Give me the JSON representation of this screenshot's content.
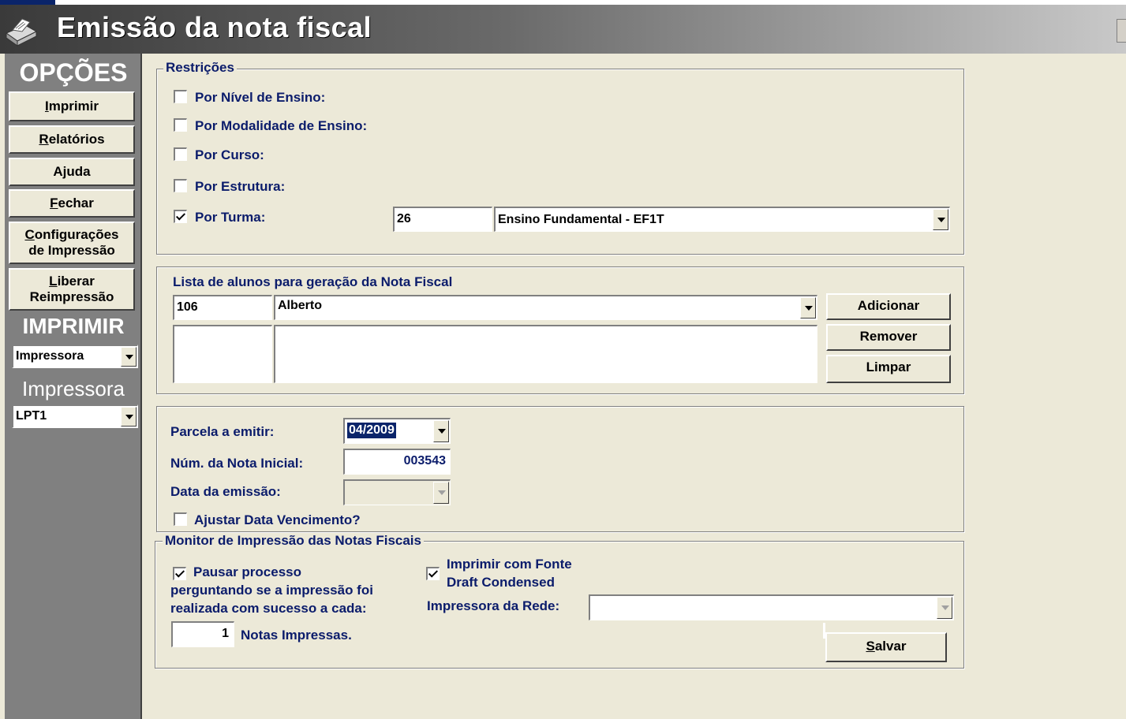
{
  "window": {
    "title": "Emissão da nota fiscal"
  },
  "sidebar": {
    "options_heading": "OPÇÕES",
    "buttons": [
      {
        "id": "imprimir",
        "label": "Imprimir"
      },
      {
        "id": "relatorios",
        "label": "Relatórios"
      },
      {
        "id": "ajuda",
        "label": "Ajuda"
      },
      {
        "id": "fechar",
        "label": "Fechar"
      },
      {
        "id": "configuracoes",
        "line1": "Configurações",
        "line2": "de Impressão"
      },
      {
        "id": "liberar",
        "line1": "Liberar",
        "line2": "Reimpressão"
      }
    ],
    "print_heading": "IMPRIMIR",
    "print_target": "Impressora",
    "printer_heading": "Impressora",
    "printer_port": "LPT1"
  },
  "restricoes": {
    "title": "Restrições",
    "items": [
      {
        "label": "Por Nível de Ensino:",
        "checked": false
      },
      {
        "label": "Por Modalidade de Ensino:",
        "checked": false
      },
      {
        "label": "Por Curso:",
        "checked": false
      },
      {
        "label": "Por Estrutura:",
        "checked": false
      },
      {
        "label": "Por Turma:",
        "checked": true
      }
    ],
    "turma_code": "26",
    "turma_name": "Ensino Fundamental - EF1T"
  },
  "lista_alunos": {
    "title": "Lista de alunos para geração da Nota Fiscal",
    "aluno_code": "106",
    "aluno_name": "Alberto",
    "add_label": "Adicionar",
    "remove_label": "Remover",
    "clear_label": "Limpar"
  },
  "emissao": {
    "parcela_label": "Parcela a emitir:",
    "parcela_value": "04/2009",
    "nota_label": "Núm. da Nota Inicial:",
    "nota_value": "003543",
    "data_label": "Data da emissão:",
    "data_value": "",
    "ajustar_label": "Ajustar Data Vencimento?"
  },
  "monitor": {
    "title": "Monitor de Impressão das Notas Fiscais",
    "pausar_line1": "Pausar processo",
    "pausar_line2": "perguntando se a impressão foi",
    "pausar_line3": "realizada com sucesso a cada:",
    "count_value": "1",
    "count_label": "Notas Impressas.",
    "draft_line1": "Imprimir com Fonte",
    "draft_line2": "Draft Condensed",
    "rede_label": "Impressora da Rede:",
    "rede_value": "",
    "save_label": "Salvar"
  }
}
